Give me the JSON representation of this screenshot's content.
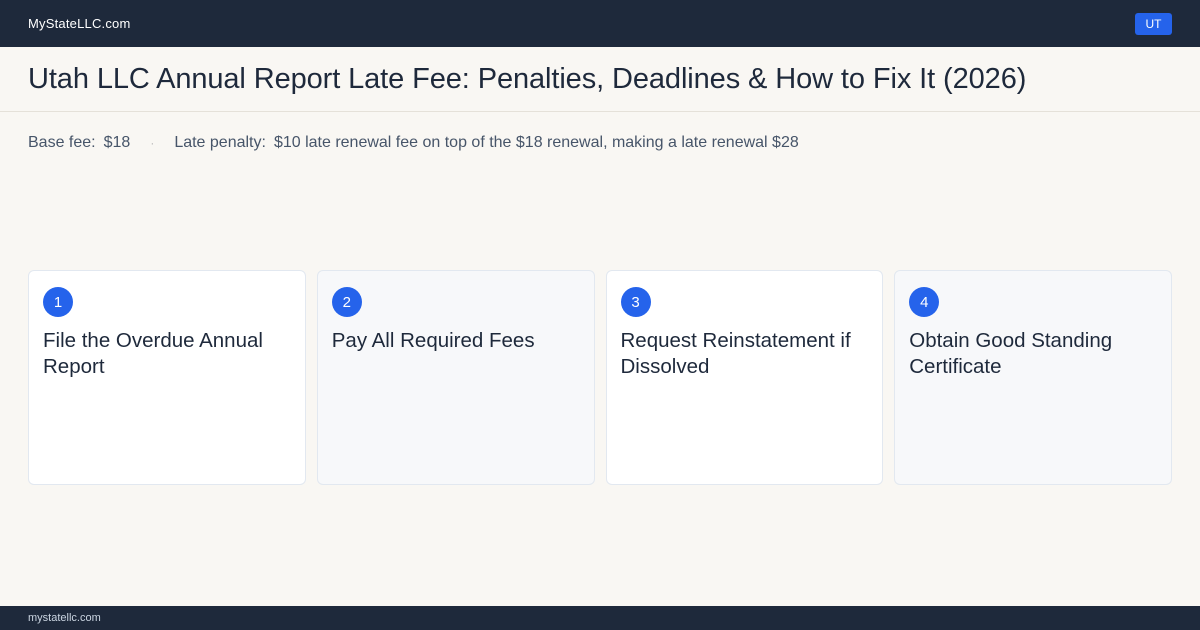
{
  "header": {
    "brand": "MyStateLLC.com",
    "state_badge": "UT"
  },
  "page": {
    "title": "Utah LLC Annual Report Late Fee: Penalties, Deadlines & How to Fix It (2026)"
  },
  "fees": {
    "base_label": "Base fee:",
    "base_value": "$18",
    "separator": "·",
    "late_label": "Late penalty:",
    "late_value": "$10 late renewal fee on top of the $18 renewal, making a late renewal $28"
  },
  "steps": [
    {
      "number": "1",
      "title": "File the Overdue Annual Report"
    },
    {
      "number": "2",
      "title": "Pay All Required Fees"
    },
    {
      "number": "3",
      "title": "Request Reinstatement if Dissolved"
    },
    {
      "number": "4",
      "title": "Obtain Good Standing Certificate"
    }
  ],
  "footer": {
    "domain": "mystatellc.com"
  },
  "colors": {
    "navy": "#1e293b",
    "accent": "#2563eb",
    "background": "#f9f7f3"
  }
}
